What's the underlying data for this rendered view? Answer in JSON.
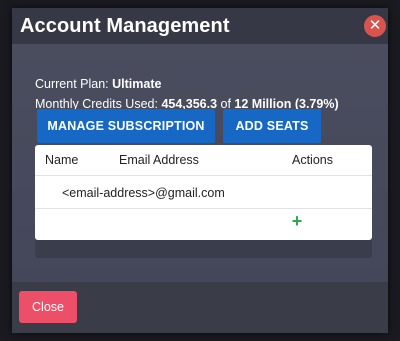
{
  "modal": {
    "title": "Account Management",
    "close_icon": "close-icon"
  },
  "plan": {
    "label": "Current Plan: ",
    "value": "Ultimate"
  },
  "credits": {
    "label": "Monthly Credits Used: ",
    "used": "454,356.3",
    "of_label": " of ",
    "total": "12 Million (3.79%)"
  },
  "buttons": {
    "manage_subscription": "MANAGE SUBSCRIPTION",
    "add_seats": "ADD SEATS",
    "close": "Close"
  },
  "table": {
    "columns": [
      "Name",
      "Email Address",
      "Actions"
    ],
    "rows": [
      {
        "name": "",
        "email": "<email-address>@gmail.com",
        "actions": ""
      }
    ],
    "add_row_icon": "plus-icon"
  },
  "colors": {
    "primary_button": "#1768c4",
    "close_button": "#ee4f68",
    "close_icon_bg": "#d9534f",
    "add_icon": "#2fa84f"
  }
}
